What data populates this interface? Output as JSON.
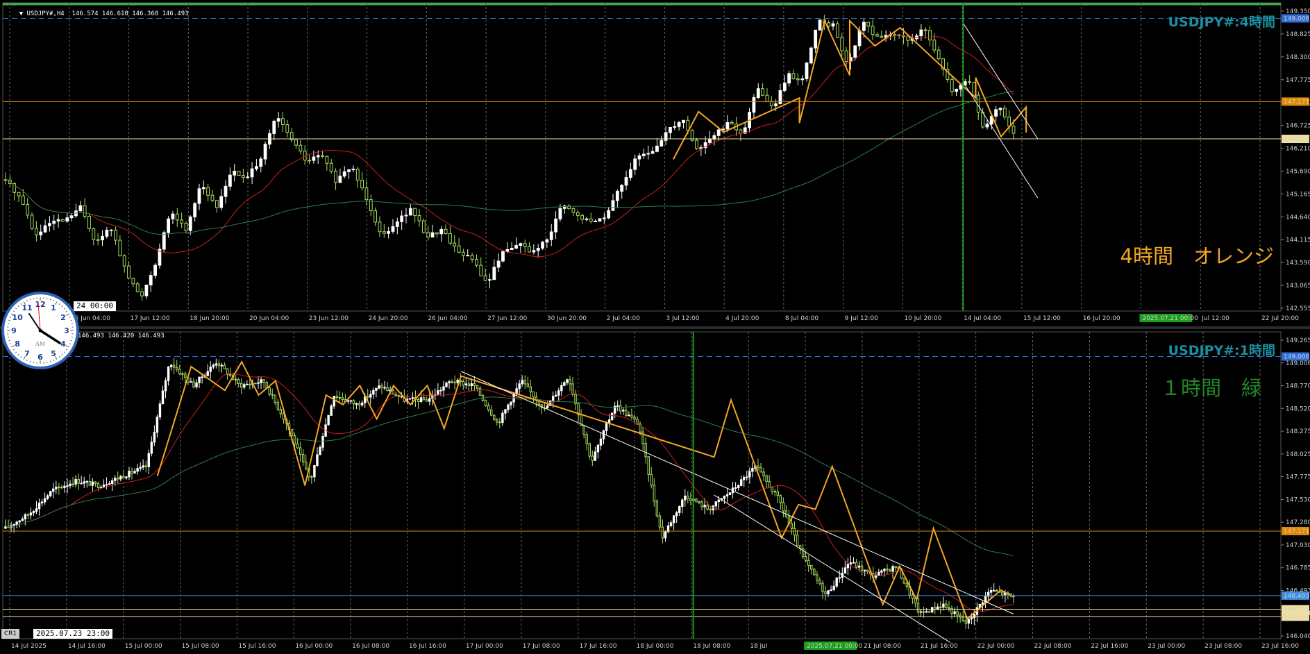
{
  "colors": {
    "background": "#000000",
    "bull": "#ffffff",
    "bear": "#a8e060",
    "ma_fast": "#cc1f1f",
    "ma_slow": "#2e7d4a",
    "zigzag_4h": "#f5a623",
    "zigzag_1h": "#f5a623",
    "channel": "#ffffff",
    "marker_line": "#1aa01a",
    "dashed_level": "#2e6ed6",
    "level_147171": "#e08a00",
    "level_146350": "#f0e0a0",
    "level_blue": "#3a8fe0",
    "title": "#1a8fa0",
    "note_orange": "#f5a623",
    "note_green": "#1f8a2a"
  },
  "clock": {
    "number_labels": [
      "12",
      "1",
      "2",
      "3",
      "4",
      "5",
      "6",
      "7",
      "8",
      "9",
      "10",
      "11"
    ],
    "ampm": "AM"
  },
  "cr_tag": "CR1",
  "chart_data": [
    {
      "type": "candlestick",
      "symbol_header": "USDJPY#,H4  146.574 146.618 146.368 146.493",
      "title": "USDJPY#:4時間",
      "note": "4時間　オレンジ",
      "ylim": [
        142.555,
        149.35
      ],
      "y_ticks": [
        "149.350",
        "148.825",
        "148.300",
        "147.775",
        "147.250",
        "146.725",
        "146.210",
        "145.690",
        "145.165",
        "144.640",
        "144.115",
        "143.590",
        "143.065",
        "142.555"
      ],
      "x_ticks": [
        "9",
        "16 Jun 04:00",
        "17 Jun 12:00",
        "18 Jun 20:00",
        "20 Jun 04:00",
        "23 Jun 12:00",
        "24 Jun 20:00",
        "26 Jun 04:00",
        "27 Jun 12:00",
        "30 Jun 20:00",
        "2 Jul 04:00",
        "3 Jul 12:00",
        "4 Jul 20:00",
        "8 Jul 04:00",
        "9 Jul 12:00",
        "10 Jul 20:00",
        "14 Jul 04:00",
        "15 Jul 12:00",
        "16 Jul 20:00",
        "2025.07.21 00:00",
        "Jul 12:00",
        "22 Jul 20:00"
      ],
      "marker_label": "2025.07.21 00:00",
      "crosshair_time": "24 00:00",
      "levels": [
        {
          "value": 149.006,
          "label": "149.006",
          "style": "dashed",
          "color_key": "dashed_level"
        },
        {
          "value": 147.171,
          "label": "147.171",
          "style": "solid",
          "color_key": "level_147171"
        },
        {
          "value": 146.35,
          "label": "146.350",
          "style": "solid",
          "color_key": "level_146350"
        }
      ],
      "key_points": [
        145.45,
        145.05,
        144.2,
        144.5,
        144.55,
        144.85,
        144.05,
        144.4,
        143.4,
        142.85,
        143.65,
        144.75,
        144.35,
        145.4,
        144.8,
        145.65,
        145.45,
        145.95,
        146.85,
        146.35,
        145.85,
        146.0,
        145.4,
        145.75,
        145.05,
        144.2,
        144.55,
        144.8,
        144.2,
        144.35,
        143.9,
        143.7,
        143.15,
        143.85,
        144.05,
        143.85,
        144.1,
        144.9,
        144.65,
        144.5,
        144.7,
        145.4,
        145.95,
        146.05,
        146.55,
        146.8,
        146.1,
        146.4,
        146.7,
        146.45,
        147.5,
        147.0,
        147.75,
        147.65,
        148.95,
        148.85,
        147.95,
        148.95,
        148.55,
        148.7,
        148.5,
        148.8,
        148.1,
        147.35,
        147.7,
        146.55,
        147.05,
        146.49
      ],
      "key_times": [
        "2025-06-13",
        "2025-06-13",
        "2025-06-16",
        "2025-06-16",
        "2025-06-17",
        "2025-06-17",
        "2025-06-17",
        "2025-06-18",
        "2025-06-18",
        "2025-06-19",
        "2025-06-19",
        "2025-06-20",
        "2025-06-20",
        "2025-06-20",
        "2025-06-23",
        "2025-06-23",
        "2025-06-23",
        "2025-06-24",
        "2025-06-24",
        "2025-06-24",
        "2025-06-25",
        "2025-06-25",
        "2025-06-26",
        "2025-06-26",
        "2025-06-27",
        "2025-06-27",
        "2025-06-30",
        "2025-06-30",
        "2025-06-30",
        "2025-07-01",
        "2025-07-01",
        "2025-07-02",
        "2025-07-02",
        "2025-07-02",
        "2025-07-03",
        "2025-07-03",
        "2025-07-04",
        "2025-07-04",
        "2025-07-07",
        "2025-07-07",
        "2025-07-08",
        "2025-07-08",
        "2025-07-09",
        "2025-07-09",
        "2025-07-09",
        "2025-07-10",
        "2025-07-10",
        "2025-07-10",
        "2025-07-11",
        "2025-07-11",
        "2025-07-14",
        "2025-07-14",
        "2025-07-14",
        "2025-07-15",
        "2025-07-15",
        "2025-07-15",
        "2025-07-16",
        "2025-07-16",
        "2025-07-17",
        "2025-07-17",
        "2025-07-18",
        "2025-07-21",
        "2025-07-21",
        "2025-07-22",
        "2025-07-22",
        "2025-07-23",
        "2025-07-23",
        "2025-07-23"
      ],
      "zigzag": [
        {
          "t": "2025-07-09",
          "y": 145.9
        },
        {
          "t": "2025-07-10",
          "y": 146.95
        },
        {
          "t": "2025-07-11",
          "y": 146.5
        },
        {
          "t": "2025-07-14",
          "y": 147.25
        },
        {
          "t": "2025-07-14",
          "y": 146.7
        },
        {
          "t": "2025-07-15",
          "y": 148.95
        },
        {
          "t": "2025-07-16",
          "y": 147.75
        },
        {
          "t": "2025-07-16",
          "y": 148.95
        },
        {
          "t": "2025-07-17",
          "y": 148.4
        },
        {
          "t": "2025-07-18",
          "y": 148.8
        },
        {
          "t": "2025-07-21",
          "y": 147.25
        },
        {
          "t": "2025-07-21",
          "y": 147.7
        },
        {
          "t": "2025-07-22",
          "y": 146.4
        },
        {
          "t": "2025-07-23",
          "y": 147.05
        },
        {
          "t": "2025-07-23",
          "y": 146.49
        }
      ]
    },
    {
      "type": "candlestick",
      "symbol_header": "146.493 146.420 146.493",
      "title": "USDJPY#:1時間",
      "note": "１時間　緑",
      "ylim": [
        146.04,
        149.265
      ],
      "y_ticks": [
        "149.265",
        "149.006",
        "148.770",
        "148.520",
        "148.275",
        "148.025",
        "147.775",
        "147.530",
        "147.280",
        "147.030",
        "146.785",
        "146.493",
        "146.271",
        "146.040"
      ],
      "x_ticks": [
        "14 Jul 2025",
        "14 Jul 16:00",
        "15 Jul 00:00",
        "15 Jul 08:00",
        "15 Jul 16:00",
        "16 Jul 00:00",
        "16 Jul 08:00",
        "16 Jul 16:00",
        "17 Jul 00:00",
        "17 Jul 08:00",
        "17 Jul 16:00",
        "18 Jul 00:00",
        "18 Jul 08:00",
        "18 Jul",
        "2025.07.21 00:00",
        "21 Jul 08:00",
        "21 Jul 16:00",
        "22 Jul 00:00",
        "22 Jul 08:00",
        "22 Jul 16:00",
        "23 Jul 00:00",
        "23 Jul 08:00",
        "23 Jul 16:00"
      ],
      "marker_label": "2025.07.21 00:00",
      "crosshair_time": "2025.07.23 23:00",
      "levels": [
        {
          "value": 149.006,
          "label": "149.006",
          "style": "dashed",
          "color_key": "dashed_level"
        },
        {
          "value": 147.171,
          "label": "147.171",
          "style": "solid",
          "color_key": "level_147171"
        },
        {
          "value": 146.493,
          "label": "146.493",
          "style": "solid",
          "color_key": "level_blue"
        },
        {
          "value": 146.35,
          "label": "146.350",
          "style": "solid",
          "color_key": "level_146350"
        },
        {
          "value": 146.271,
          "label": "146.271",
          "style": "solid",
          "color_key": "level_146350"
        }
      ],
      "key_points": [
        147.2,
        147.35,
        147.6,
        147.7,
        147.65,
        147.75,
        147.85,
        148.95,
        148.7,
        148.95,
        148.7,
        148.75,
        148.3,
        147.7,
        148.6,
        148.5,
        148.7,
        148.55,
        148.55,
        148.75,
        148.7,
        148.3,
        148.75,
        148.45,
        148.8,
        147.9,
        148.5,
        148.3,
        147.1,
        147.55,
        147.4,
        147.6,
        147.85,
        147.5,
        146.9,
        146.5,
        146.85,
        146.7,
        146.8,
        146.3,
        146.4,
        146.2,
        146.55,
        146.48
      ],
      "key_times": [
        "2025-07-14 00:00",
        "2025-07-14 08:00",
        "2025-07-14 16:00",
        "2025-07-15 00:00",
        "2025-07-15 08:00",
        "2025-07-15 12:00",
        "2025-07-15 16:00",
        "2025-07-15 20:00",
        "2025-07-16 04:00",
        "2025-07-16 08:00",
        "2025-07-16 12:00",
        "2025-07-16 16:00",
        "2025-07-16 20:00",
        "2025-07-16 23:00",
        "2025-07-17 04:00",
        "2025-07-17 08:00",
        "2025-07-17 12:00",
        "2025-07-17 16:00",
        "2025-07-17 20:00",
        "2025-07-18 00:00",
        "2025-07-18 04:00",
        "2025-07-18 08:00",
        "2025-07-18 12:00",
        "2025-07-21 00:00",
        "2025-07-21 04:00",
        "2025-07-21 08:00",
        "2025-07-21 12:00",
        "2025-07-21 16:00",
        "2025-07-21 20:00",
        "2025-07-22 00:00",
        "2025-07-22 02:00",
        "2025-07-22 04:00",
        "2025-07-22 06:00",
        "2025-07-22 08:00",
        "2025-07-22 12:00",
        "2025-07-22 16:00",
        "2025-07-22 20:00",
        "2025-07-23 00:00",
        "2025-07-23 04:00",
        "2025-07-23 08:00",
        "2025-07-23 12:00",
        "2025-07-23 16:00",
        "2025-07-23 20:00",
        "2025-07-23 23:00"
      ],
      "zigzag": [
        {
          "t": "2025-07-15 12:00",
          "y": 147.75
        },
        {
          "t": "2025-07-15 20:00",
          "y": 148.9
        },
        {
          "t": "2025-07-16 04:00",
          "y": 148.65
        },
        {
          "t": "2025-07-16 08:00",
          "y": 148.95
        },
        {
          "t": "2025-07-16 12:00",
          "y": 148.6
        },
        {
          "t": "2025-07-16 16:00",
          "y": 148.75
        },
        {
          "t": "2025-07-16 23:00",
          "y": 147.65
        },
        {
          "t": "2025-07-17 04:00",
          "y": 148.6
        },
        {
          "t": "2025-07-17 08:00",
          "y": 148.5
        },
        {
          "t": "2025-07-17 12:00",
          "y": 148.7
        },
        {
          "t": "2025-07-17 16:00",
          "y": 148.35
        },
        {
          "t": "2025-07-17 20:00",
          "y": 148.7
        },
        {
          "t": "2025-07-18 00:00",
          "y": 148.5
        },
        {
          "t": "2025-07-18 04:00",
          "y": 148.7
        },
        {
          "t": "2025-07-18 08:00",
          "y": 148.25
        },
        {
          "t": "2025-07-18 12:00",
          "y": 148.8
        },
        {
          "t": "2025-07-21 00:00",
          "y": 147.95
        },
        {
          "t": "2025-07-21 04:00",
          "y": 148.55
        },
        {
          "t": "2025-07-21 16:00",
          "y": 147.1
        },
        {
          "t": "2025-07-21 20:00",
          "y": 147.45
        },
        {
          "t": "2025-07-22 00:00",
          "y": 147.4
        },
        {
          "t": "2025-07-22 04:00",
          "y": 147.85
        },
        {
          "t": "2025-07-22 16:00",
          "y": 146.4
        },
        {
          "t": "2025-07-22 20:00",
          "y": 146.8
        },
        {
          "t": "2025-07-23 00:00",
          "y": 146.45
        },
        {
          "t": "2025-07-23 04:00",
          "y": 147.2
        },
        {
          "t": "2025-07-23 12:00",
          "y": 146.25
        },
        {
          "t": "2025-07-23 20:00",
          "y": 146.55
        },
        {
          "t": "2025-07-23 23:00",
          "y": 146.48
        }
      ]
    }
  ]
}
